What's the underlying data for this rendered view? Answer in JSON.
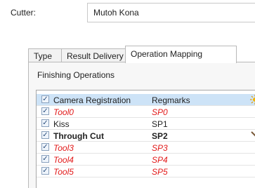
{
  "cutter": {
    "label": "Cutter:",
    "value": "Mutoh Kona"
  },
  "tabs": [
    {
      "label": "Type"
    },
    {
      "label": "Result Delivery"
    },
    {
      "label": "Operation Mapping"
    }
  ],
  "section": {
    "title": "Finishing Operations"
  },
  "rows": [
    {
      "name": "Camera Registration",
      "reg": "Regmarks",
      "style": "normal",
      "checked": true,
      "icon": "sun-icon"
    },
    {
      "name": "Tool0",
      "reg": "SP0",
      "style": "red",
      "checked": true,
      "icon": ""
    },
    {
      "name": "Kiss",
      "reg": "SP1",
      "style": "normal",
      "checked": true,
      "icon": ""
    },
    {
      "name": "Through Cut",
      "reg": "SP2",
      "style": "bold",
      "checked": true,
      "icon": "knife-icon"
    },
    {
      "name": "Tool3",
      "reg": "SP3",
      "style": "red",
      "checked": true,
      "icon": ""
    },
    {
      "name": "Tool4",
      "reg": "SP4",
      "style": "red",
      "checked": true,
      "icon": ""
    },
    {
      "name": "Tool5",
      "reg": "SP5",
      "style": "red",
      "checked": true,
      "icon": ""
    }
  ],
  "colors": {
    "red": "#e21a1a",
    "selected_row": "#cde3f7"
  }
}
